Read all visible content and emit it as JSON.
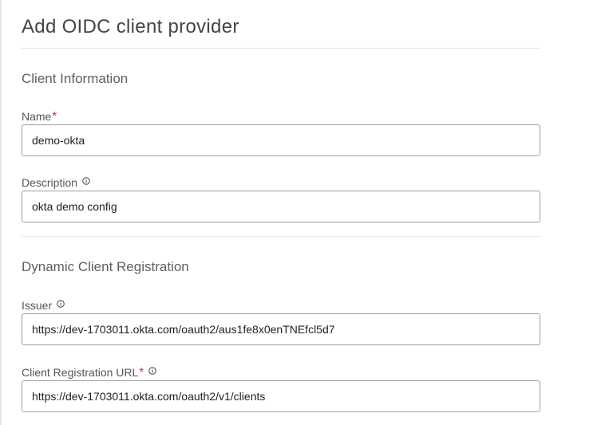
{
  "page": {
    "title": "Add OIDC client provider"
  },
  "sections": {
    "client_information": {
      "title": "Client Information",
      "name": {
        "label": "Name",
        "required": "*",
        "value": "demo-okta"
      },
      "description": {
        "label": "Description",
        "value": "okta demo config"
      }
    },
    "dynamic_client_registration": {
      "title": "Dynamic Client Registration",
      "issuer": {
        "label": "Issuer",
        "value": "https://dev-1703011.okta.com/oauth2/aus1fe8x0enTNEfcl5d7"
      },
      "client_registration_url": {
        "label": "Client Registration URL",
        "required": "*",
        "value": "https://dev-1703011.okta.com/oauth2/v1/clients"
      }
    }
  },
  "icons": {
    "info": "info-circle-icon"
  },
  "colors": {
    "required": "#c0392b",
    "border": "#9d9d9d",
    "divider": "#e6e6e6"
  }
}
